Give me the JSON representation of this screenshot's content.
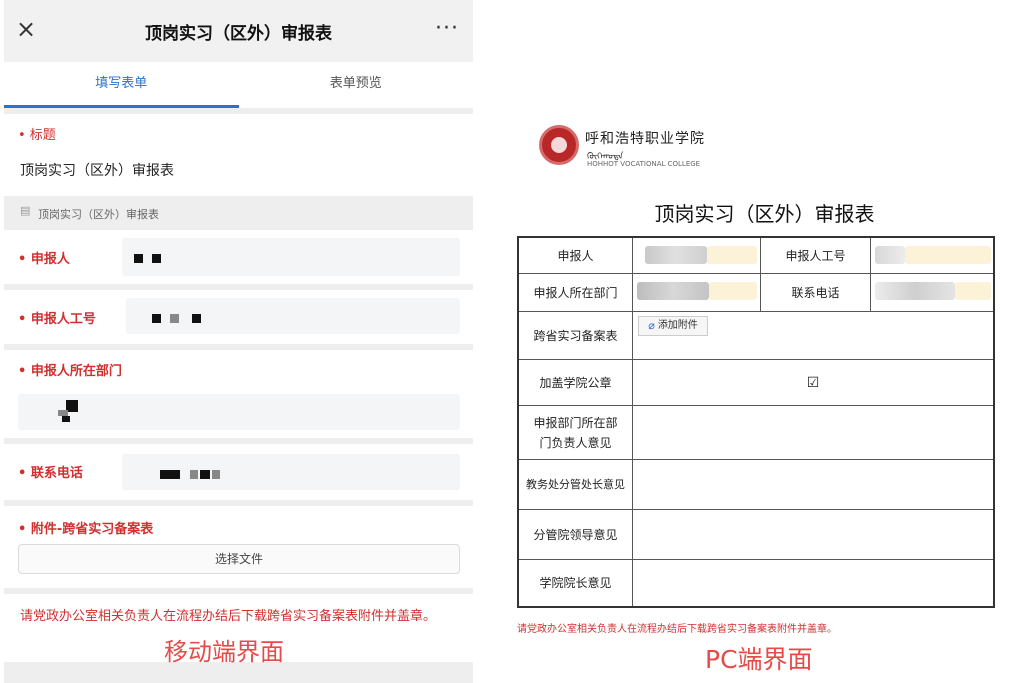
{
  "mobile": {
    "header": {
      "close_icon": "×",
      "title": "顶岗实习（区外）审报表",
      "more_icon": "···"
    },
    "tabs": [
      {
        "label": "填写表单"
      },
      {
        "label": "表单预览"
      }
    ],
    "title_field": {
      "label": "• 标题",
      "value": "顶岗实习（区外）审报表"
    },
    "form_name": "顶岗实习（区外）审报表",
    "applicant": {
      "label": "• 申报人"
    },
    "employee_id": {
      "label": "• 申报人工号"
    },
    "department": {
      "label": "• 申报人所在部门"
    },
    "phone": {
      "label": "• 联系电话"
    },
    "attachment": {
      "label": "• 附件-跨省实习备案表",
      "button": "选择文件"
    },
    "notice": "请党政办公室相关负责人在流程办结后下载跨省实习备案表附件并盖章。",
    "caption": "移动端界面"
  },
  "pc": {
    "school_cn": "呼和浩特职业学院",
    "school_mn": "ᠬᠥᠬᠡᠬᠣᠲᠠ",
    "school_en": "HOHHOT VOCATIONAL COLLEGE",
    "title": "顶岗实习（区外）审报表",
    "table": {
      "applicant": "申报人",
      "employee_id": "申报人工号",
      "department": "申报人所在部门",
      "phone": "联系电话",
      "attachment": "跨省实习备案表",
      "attach_button": "添加附件",
      "seal": "加盖学院公章",
      "seal_check": "☑",
      "dept_opinion": "申报部门所在部门负责人意见",
      "academic_opinion": "教务处分管处长意见",
      "leader_opinion": "分管院领导意见",
      "president_opinion": "学院院长意见"
    },
    "notice": "请党政办公室相关负责人在流程办结后下载跨省实习备案表附件并盖章。",
    "caption": "PC端界面"
  },
  "colors": {
    "accent": "#2a73c9",
    "required": "#d03030",
    "caption": "#e84a4a"
  }
}
